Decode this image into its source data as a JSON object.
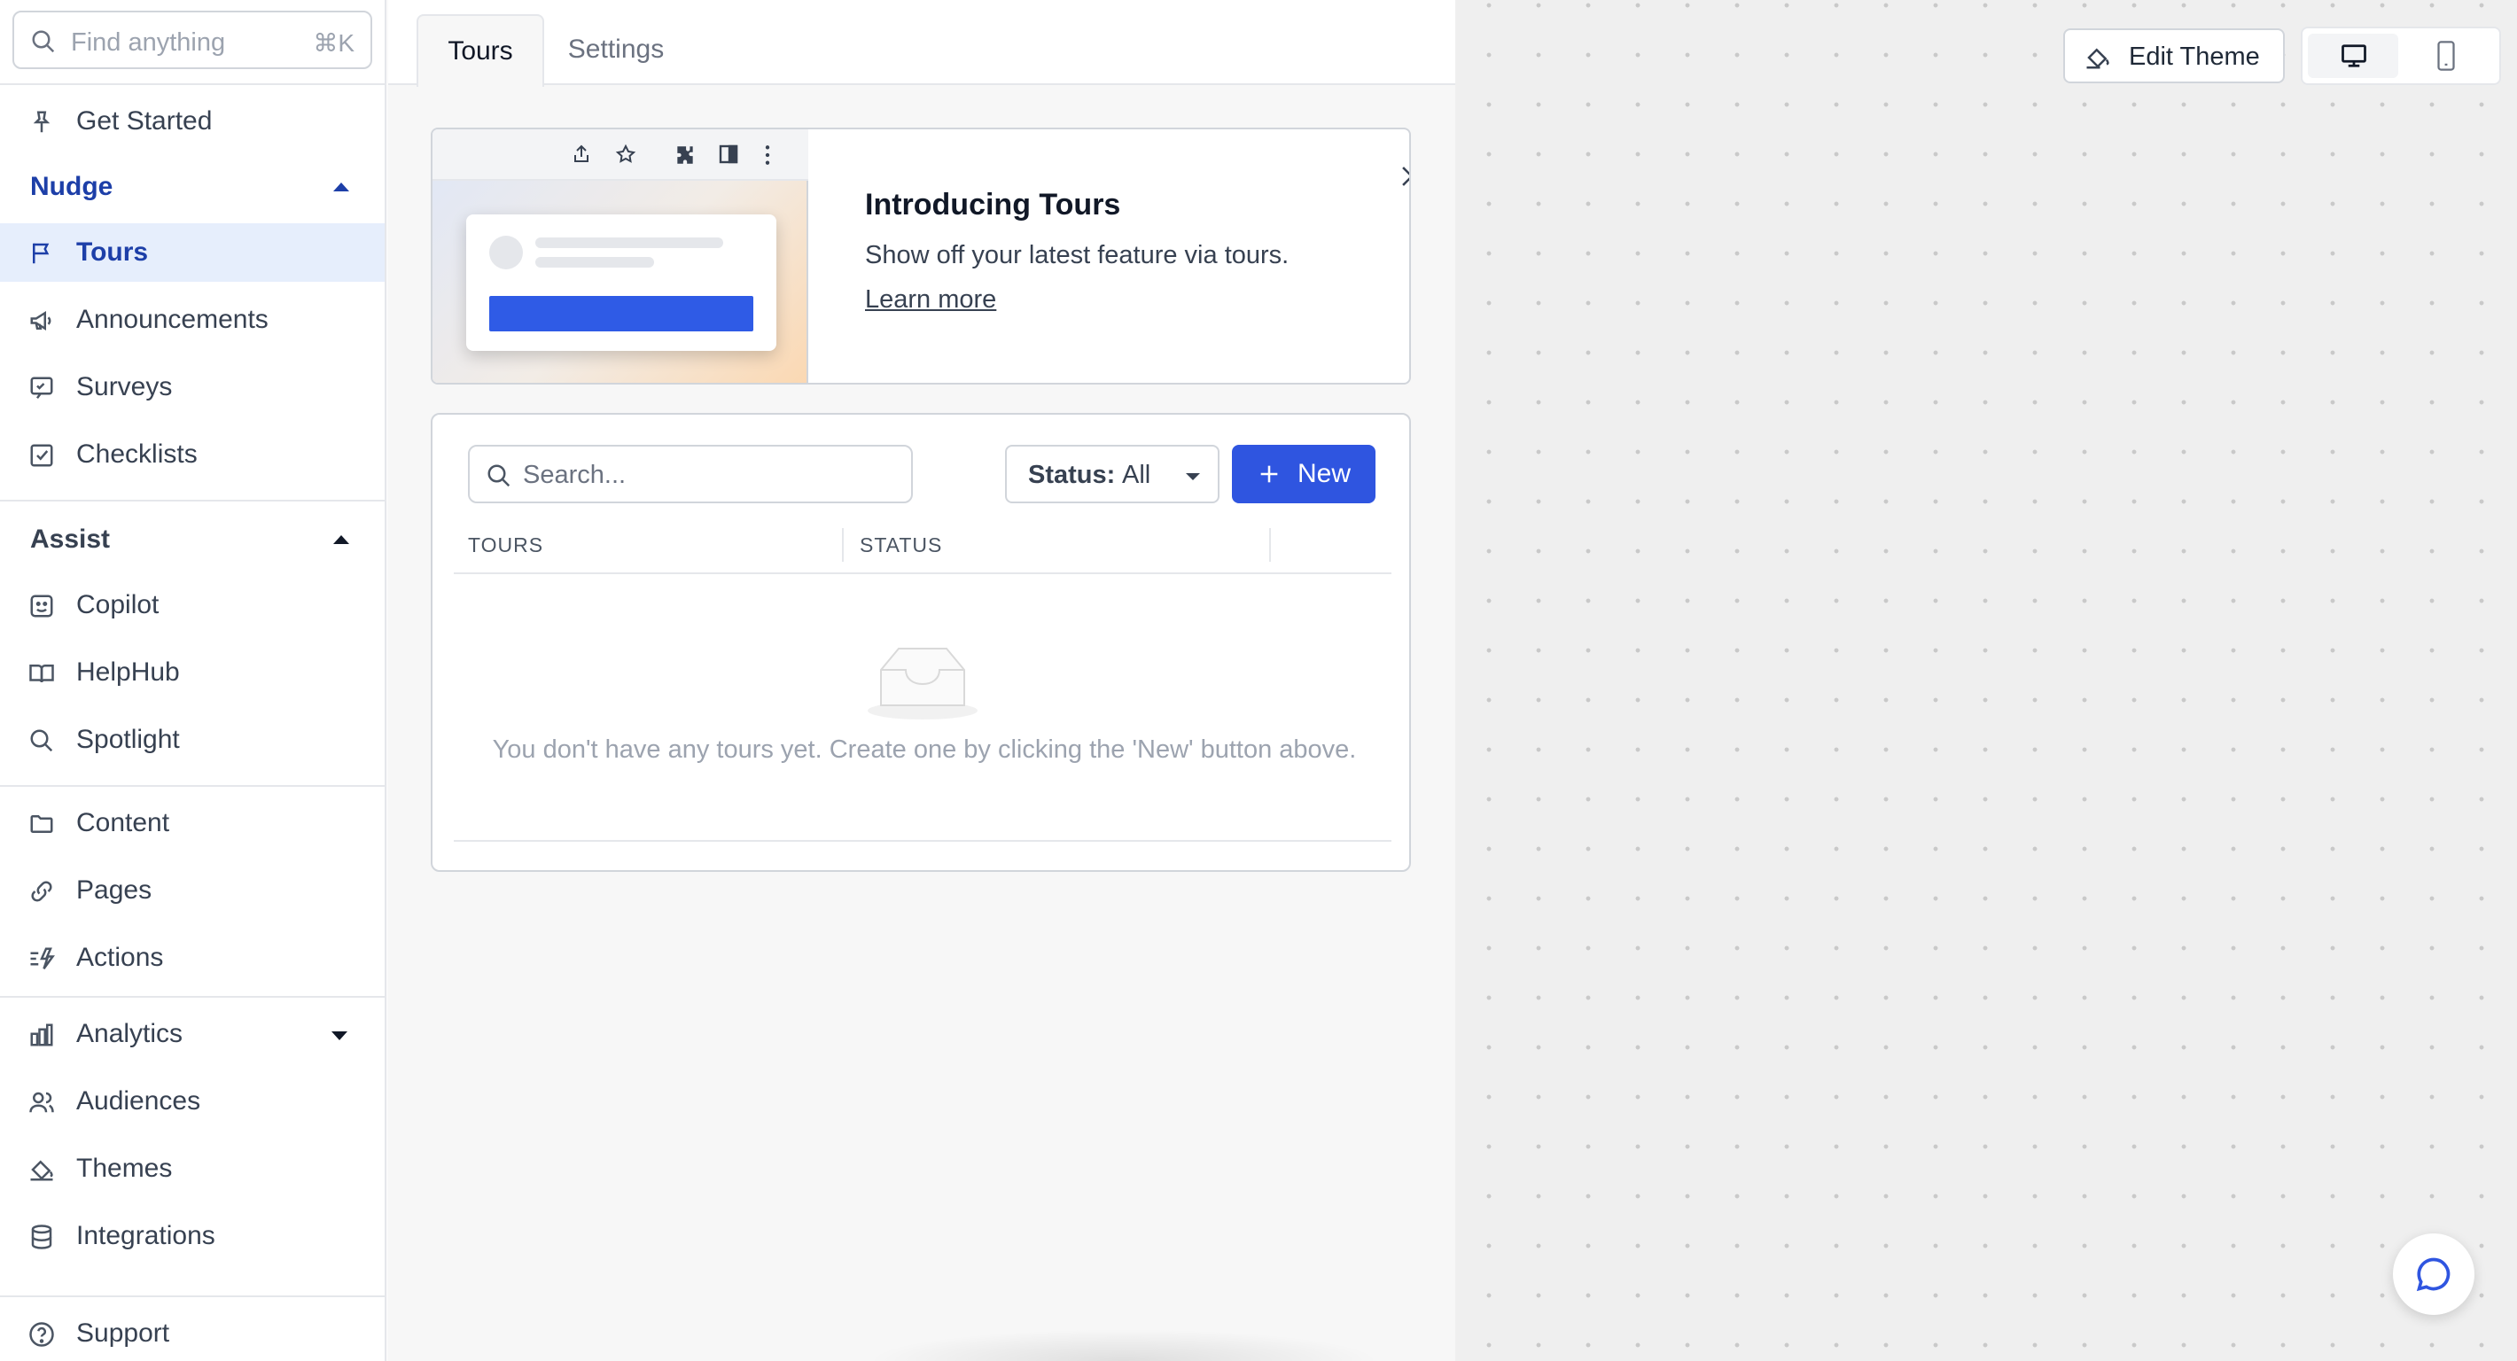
{
  "search": {
    "placeholder": "Find anything",
    "shortcut": "⌘K"
  },
  "sidebar": {
    "get_started": "Get Started",
    "nudge": {
      "label": "Nudge",
      "items": [
        "Tours",
        "Announcements",
        "Surveys",
        "Checklists"
      ]
    },
    "assist": {
      "label": "Assist",
      "items": [
        "Copilot",
        "HelpHub",
        "Spotlight"
      ]
    },
    "library": [
      "Content",
      "Pages",
      "Actions"
    ],
    "analytics": "Analytics",
    "misc": [
      "Audiences",
      "Themes",
      "Integrations"
    ],
    "support": "Support",
    "active_item": "Tours"
  },
  "tabs": [
    "Tours",
    "Settings"
  ],
  "banner": {
    "title": "Introducing Tours",
    "description": "Show off your latest feature via tours.",
    "link": "Learn more"
  },
  "toolbar": {
    "search_placeholder": "Search...",
    "status_key": "Status:",
    "status_value": "All",
    "new_label": "New"
  },
  "table": {
    "columns": [
      "TOURS",
      "STATUS"
    ],
    "empty_message": "You don't have any tours yet. Create one by clicking the 'New' button above."
  },
  "preview": {
    "edit_theme": "Edit Theme"
  },
  "colors": {
    "accent": "#2f55e0",
    "active_bg": "#e6eefc",
    "active_text": "#1d3fa8"
  }
}
